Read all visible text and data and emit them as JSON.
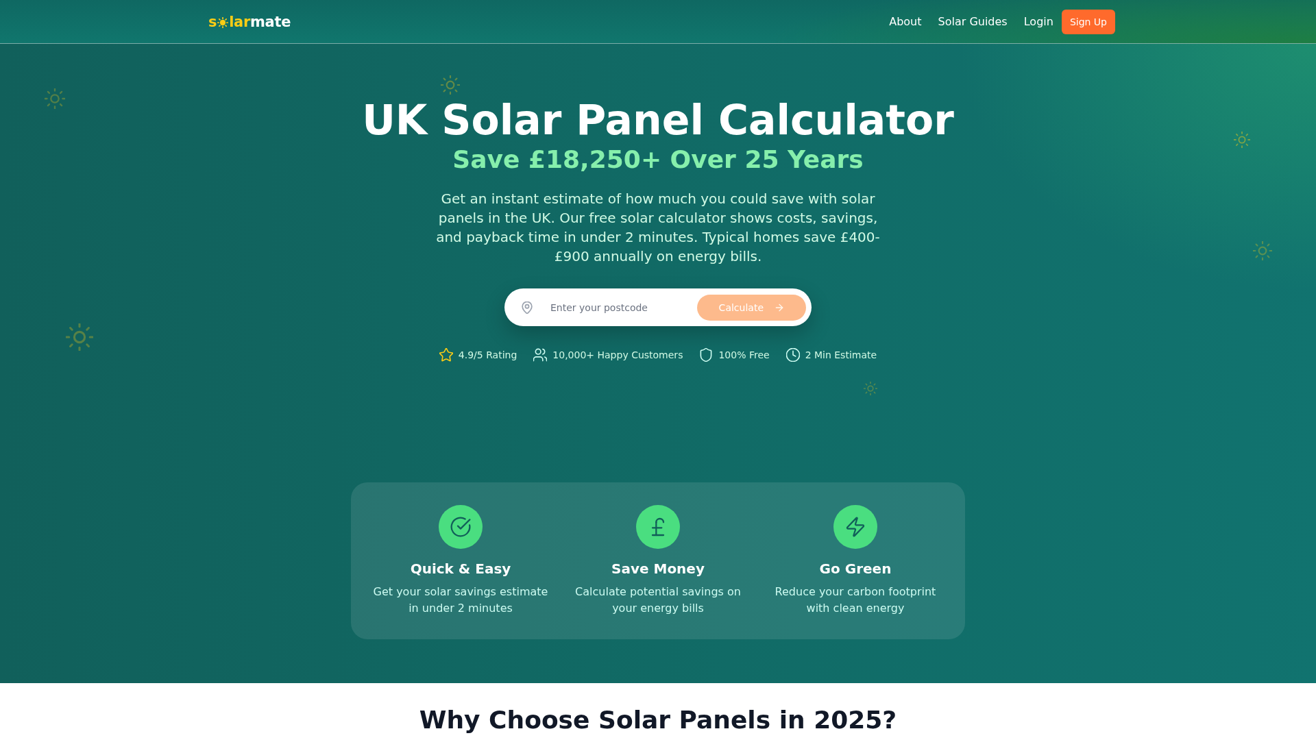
{
  "header": {
    "logo": {
      "start": "s",
      "accent": "lar",
      "end": "mate"
    },
    "nav": [
      {
        "kind": "link",
        "label": "About"
      },
      {
        "kind": "link",
        "label": "Solar Guides"
      },
      {
        "kind": "link",
        "label": "Login"
      },
      {
        "kind": "button",
        "label": "Sign Up"
      }
    ]
  },
  "hero": {
    "title": "UK Solar Panel Calculator",
    "subtitle": "Save £18,250+ Over 25 Years",
    "description": "Get an instant estimate of how much you could save with solar panels in the UK. Our free solar calculator shows costs, savings, and payback time in under 2 minutes. Typical homes save £400-£900 annually on energy bills.",
    "search": {
      "placeholder": "Enter your postcode",
      "button": {
        "label": "Calculate",
        "disabled": true
      }
    },
    "badges": [
      {
        "kind": "star",
        "label": "4.9/5 Rating"
      },
      {
        "kind": "users",
        "label": "10,000+ Happy Customers"
      },
      {
        "kind": "shield",
        "label": "100% Free"
      },
      {
        "kind": "clock",
        "label": "2 Min Estimate"
      }
    ],
    "features": [
      {
        "kind": "check",
        "title": "Quick & Easy",
        "text": "Get your solar savings estimate in under 2 minutes"
      },
      {
        "kind": "pound",
        "title": "Save Money",
        "text": "Calculate potential savings on your energy bills"
      },
      {
        "kind": "bolt",
        "title": "Go Green",
        "text": "Reduce your carbon footprint with clean energy"
      }
    ]
  },
  "section": {
    "title": "Why Choose Solar Panels in 2025?"
  }
}
